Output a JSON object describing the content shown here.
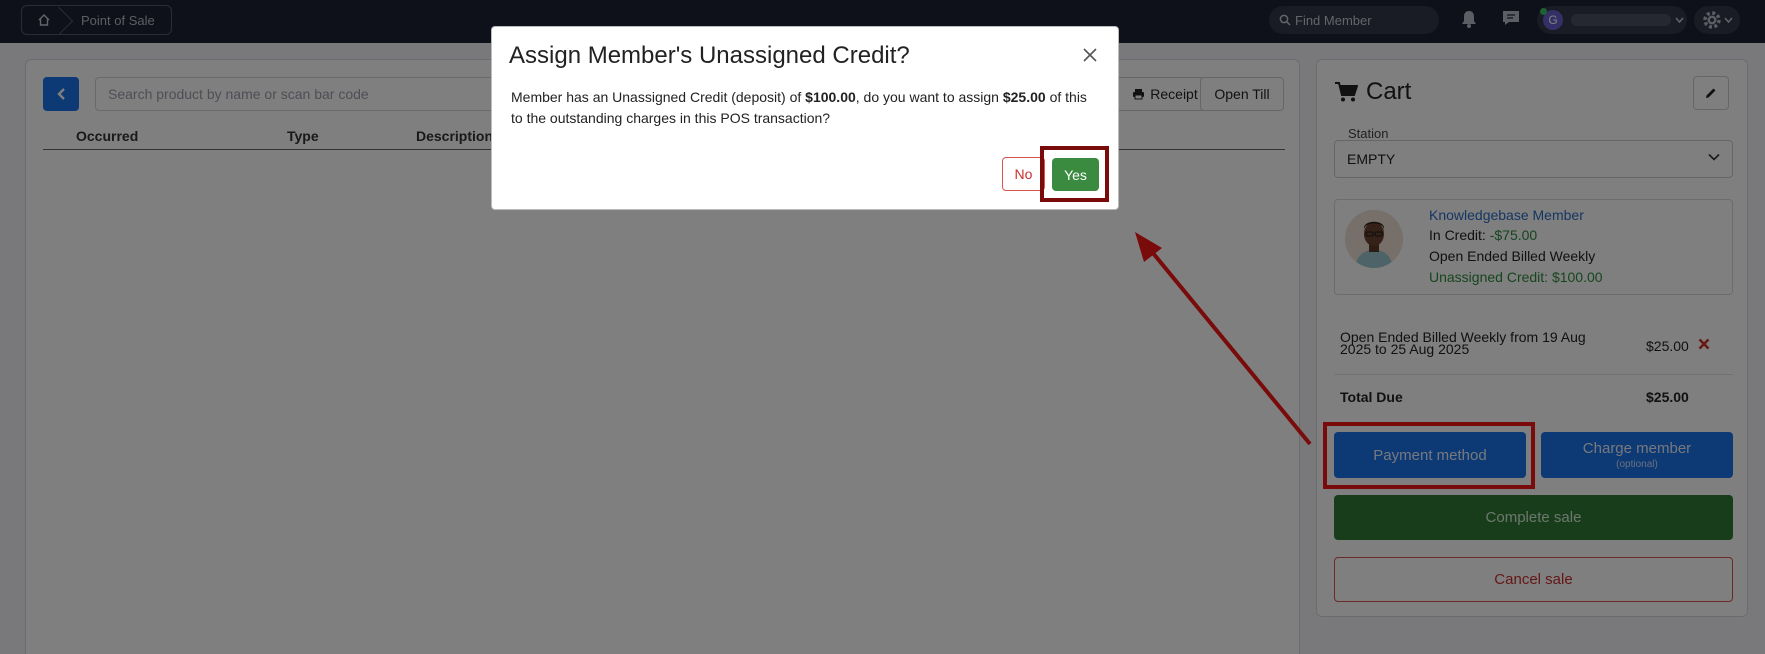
{
  "topbar": {
    "breadcrumb_label": "Point of Sale",
    "find_member_placeholder": "Find Member",
    "user_initial": "G"
  },
  "pos": {
    "search_placeholder": "Search product by name or scan bar code",
    "receipt_label": "Receipt",
    "open_till_label": "Open Till",
    "columns": [
      "Occurred",
      "Type",
      "Description"
    ]
  },
  "cart": {
    "title": "Cart",
    "station_label": "Station",
    "station_value": "EMPTY",
    "member": {
      "name": "Knowledgebase Member",
      "in_credit_label": "In Credit:",
      "in_credit_value": "-$75.00",
      "plan": "Open Ended Billed Weekly",
      "unassigned_credit": "Unassigned Credit: $100.00"
    },
    "line_item": {
      "description": "Open Ended Billed Weekly from 19 Aug 2025 to 25 Aug 2025",
      "price": "$25.00"
    },
    "total_label": "Total Due",
    "total_value": "$25.00",
    "payment_method_label": "Payment method",
    "charge_member_label": "Charge member",
    "charge_member_sub": "(optional)",
    "complete_label": "Complete sale",
    "cancel_label": "Cancel sale"
  },
  "modal": {
    "title": "Assign Member's Unassigned Credit?",
    "body_part1": "Member has an Unassigned Credit (deposit) of ",
    "body_amount1": "$100.00",
    "body_part2": ", do you want to assign ",
    "body_amount2": "$25.00",
    "body_part3": " of this to the outstanding charges in this POS transaction?",
    "no_label": "No",
    "yes_label": "Yes"
  },
  "colors": {
    "primary": "#1a73e8",
    "success": "#3a8a40",
    "danger": "#d9534f",
    "annotation": "#7a0b0b",
    "navbar": "#1f2235"
  }
}
